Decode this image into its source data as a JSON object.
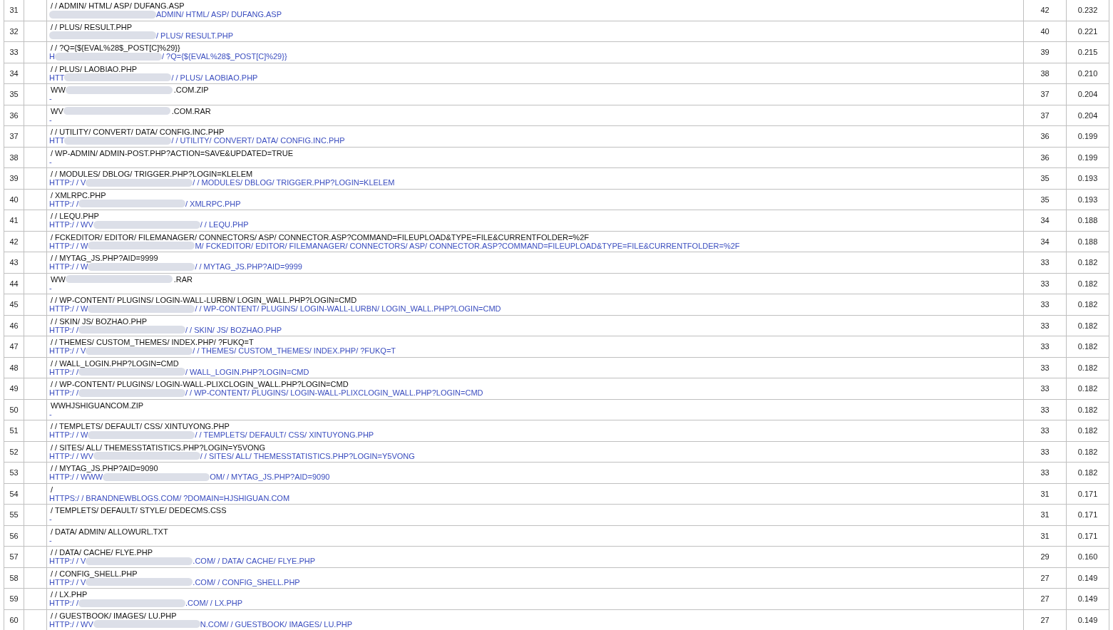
{
  "rows": [
    {
      "n": "31",
      "path": [
        {
          "text": "/ / ADMIN/ HTML/ ASP/ DUFANG.ASP"
        }
      ],
      "url": [
        {
          "kind": "redacted"
        },
        {
          "text": "ADMIN/ HTML/ ASP/ DUFANG.ASP"
        }
      ],
      "hits": "42",
      "ratio": "0.232"
    },
    {
      "n": "32",
      "path": [
        {
          "text": "/ / PLUS/ RESULT.PHP"
        }
      ],
      "url": [
        {
          "kind": "redacted"
        },
        {
          "text": "/ PLUS/ RESULT.PHP"
        }
      ],
      "hits": "40",
      "ratio": "0.221"
    },
    {
      "n": "33",
      "path": [
        {
          "text": "/ / ?Q={${EVAL%28$_POST[C]%29}}"
        }
      ],
      "url": [
        {
          "text": "H"
        },
        {
          "kind": "redacted"
        },
        {
          "text": "/ ?Q={${EVAL%28$_POST[C]%29}}"
        }
      ],
      "hits": "39",
      "ratio": "0.215"
    },
    {
      "n": "34",
      "path": [
        {
          "text": "/ / PLUS/ LAOBIAO.PHP"
        }
      ],
      "url": [
        {
          "text": "HTT"
        },
        {
          "kind": "redacted"
        },
        {
          "text": "/ / PLUS/ LAOBIAO.PHP"
        }
      ],
      "hits": "38",
      "ratio": "0.210"
    },
    {
      "n": "35",
      "path": [
        {
          "text": "WW"
        },
        {
          "kind": "redacted"
        },
        {
          "text": ".COM.ZIP"
        }
      ],
      "url": [
        {
          "text": "-"
        }
      ],
      "hits": "37",
      "ratio": "0.204"
    },
    {
      "n": "36",
      "path": [
        {
          "text": "WV"
        },
        {
          "kind": "redacted"
        },
        {
          "text": ".COM.RAR"
        }
      ],
      "url": [
        {
          "text": "-"
        }
      ],
      "hits": "37",
      "ratio": "0.204"
    },
    {
      "n": "37",
      "path": [
        {
          "text": "/ / UTILITY/ CONVERT/ DATA/ CONFIG.INC.PHP"
        }
      ],
      "url": [
        {
          "text": "HTT"
        },
        {
          "kind": "redacted"
        },
        {
          "text": "/ / UTILITY/ CONVERT/ DATA/ CONFIG.INC.PHP"
        }
      ],
      "hits": "36",
      "ratio": "0.199"
    },
    {
      "n": "38",
      "path": [
        {
          "text": "/ WP-ADMIN/ ADMIN-POST.PHP?ACTION=SAVE&UPDATED=TRUE"
        }
      ],
      "url": [
        {
          "text": "-"
        }
      ],
      "hits": "36",
      "ratio": "0.199"
    },
    {
      "n": "39",
      "path": [
        {
          "text": "/ / MODULES/ DBLOG/ TRIGGER.PHP?LOGIN=KLELEM"
        }
      ],
      "url": [
        {
          "text": "HTTP:/ / V"
        },
        {
          "kind": "redacted"
        },
        {
          "text": "/ / MODULES/ DBLOG/ TRIGGER.PHP?LOGIN=KLELEM"
        }
      ],
      "hits": "35",
      "ratio": "0.193"
    },
    {
      "n": "40",
      "path": [
        {
          "text": "/ XMLRPC.PHP"
        }
      ],
      "url": [
        {
          "text": "HTTP:/ /"
        },
        {
          "kind": "redacted"
        },
        {
          "text": "/ XMLRPC.PHP"
        }
      ],
      "hits": "35",
      "ratio": "0.193"
    },
    {
      "n": "41",
      "path": [
        {
          "text": "/ / LEQU.PHP"
        }
      ],
      "url": [
        {
          "text": "HTTP:/ / WV"
        },
        {
          "kind": "redacted"
        },
        {
          "text": "/ / LEQU.PHP"
        }
      ],
      "hits": "34",
      "ratio": "0.188"
    },
    {
      "n": "42",
      "path": [
        {
          "text": "/ FCKEDITOR/ EDITOR/ FILEMANAGER/ CONNECTORS/ ASP/ CONNECTOR.ASP?COMMAND=FILEUPLOAD&TYPE=FILE&CURRENTFOLDER=%2F"
        }
      ],
      "url": [
        {
          "text": "HTTP:/ / W"
        },
        {
          "kind": "redacted"
        },
        {
          "text": "M/ FCKEDITOR/ EDITOR/ FILEMANAGER/ CONNECTORS/ ASP/ CONNECTOR.ASP?COMMAND=FILEUPLOAD&TYPE=FILE&CURRENTFOLDER=%2F"
        }
      ],
      "hits": "34",
      "ratio": "0.188"
    },
    {
      "n": "43",
      "path": [
        {
          "text": "/ / MYTAG_JS.PHP?AID=9999"
        }
      ],
      "url": [
        {
          "text": "HTTP:/ / W"
        },
        {
          "kind": "redacted"
        },
        {
          "text": "/ / MYTAG_JS.PHP?AID=9999"
        }
      ],
      "hits": "33",
      "ratio": "0.182"
    },
    {
      "n": "44",
      "path": [
        {
          "text": "WW"
        },
        {
          "kind": "redacted"
        },
        {
          "text": ".RAR"
        }
      ],
      "url": [
        {
          "text": "-"
        }
      ],
      "hits": "33",
      "ratio": "0.182"
    },
    {
      "n": "45",
      "path": [
        {
          "text": "/ / WP-CONTENT/ PLUGINS/ LOGIN-WALL-LURBN/ LOGIN_WALL.PHP?LOGIN=CMD"
        }
      ],
      "url": [
        {
          "text": "HTTP:/ / W"
        },
        {
          "kind": "redacted"
        },
        {
          "text": "/ / WP-CONTENT/ PLUGINS/ LOGIN-WALL-LURBN/ LOGIN_WALL.PHP?LOGIN=CMD"
        }
      ],
      "hits": "33",
      "ratio": "0.182"
    },
    {
      "n": "46",
      "path": [
        {
          "text": "/ / SKIN/ JS/ BOZHAO.PHP"
        }
      ],
      "url": [
        {
          "text": "HTTP:/ /"
        },
        {
          "kind": "redacted"
        },
        {
          "text": "/ / SKIN/ JS/ BOZHAO.PHP"
        }
      ],
      "hits": "33",
      "ratio": "0.182"
    },
    {
      "n": "47",
      "path": [
        {
          "text": "/ / THEMES/ CUSTOM_THEMES/ INDEX.PHP/ ?FUKQ=T"
        }
      ],
      "url": [
        {
          "text": "HTTP:/ / V"
        },
        {
          "kind": "redacted"
        },
        {
          "text": "/ / THEMES/ CUSTOM_THEMES/ INDEX.PHP/ ?FUKQ=T"
        }
      ],
      "hits": "33",
      "ratio": "0.182"
    },
    {
      "n": "48",
      "path": [
        {
          "text": "/ / WALL_LOGIN.PHP?LOGIN=CMD"
        }
      ],
      "url": [
        {
          "text": "HTTP:/ /"
        },
        {
          "kind": "redacted"
        },
        {
          "text": "/ WALL_LOGIN.PHP?LOGIN=CMD"
        }
      ],
      "hits": "33",
      "ratio": "0.182"
    },
    {
      "n": "49",
      "path": [
        {
          "text": "/ / WP-CONTENT/ PLUGINS/ LOGIN-WALL-PLIXCLOGIN_WALL.PHP?LOGIN=CMD"
        }
      ],
      "url": [
        {
          "text": "HTTP:/ /"
        },
        {
          "kind": "redacted"
        },
        {
          "text": "/ / WP-CONTENT/ PLUGINS/ LOGIN-WALL-PLIXCLOGIN_WALL.PHP?LOGIN=CMD"
        }
      ],
      "hits": "33",
      "ratio": "0.182"
    },
    {
      "n": "50",
      "path": [
        {
          "text": "WWHJSHIGUANCOM.ZIP"
        }
      ],
      "url": [
        {
          "text": "-"
        }
      ],
      "hits": "33",
      "ratio": "0.182"
    },
    {
      "n": "51",
      "path": [
        {
          "text": "/ / TEMPLETS/ DEFAULT/ CSS/ XINTUYONG.PHP"
        }
      ],
      "url": [
        {
          "text": "HTTP:/ / W"
        },
        {
          "kind": "redacted"
        },
        {
          "text": "/ / TEMPLETS/ DEFAULT/ CSS/ XINTUYONG.PHP"
        }
      ],
      "hits": "33",
      "ratio": "0.182"
    },
    {
      "n": "52",
      "path": [
        {
          "text": "/ / SITES/ ALL/ THEMESSTATISTICS.PHP?LOGIN=Y5VONG"
        }
      ],
      "url": [
        {
          "text": "HTTP:/ / WV"
        },
        {
          "kind": "redacted"
        },
        {
          "text": "/ / SITES/ ALL/ THEMESSTATISTICS.PHP?LOGIN=Y5VONG"
        }
      ],
      "hits": "33",
      "ratio": "0.182"
    },
    {
      "n": "53",
      "path": [
        {
          "text": "/ / MYTAG_JS.PHP?AID=9090"
        }
      ],
      "url": [
        {
          "text": "HTTP:/ / WWW"
        },
        {
          "kind": "redacted"
        },
        {
          "text": "OM/ / MYTAG_JS.PHP?AID=9090"
        }
      ],
      "hits": "33",
      "ratio": "0.182"
    },
    {
      "n": "54",
      "path": [
        {
          "text": "/"
        }
      ],
      "url": [
        {
          "text": "HTTPS:/ / BRANDNEWBLOGS.COM/ ?DOMAIN=HJSHIGUAN.COM"
        }
      ],
      "hits": "31",
      "ratio": "0.171"
    },
    {
      "n": "55",
      "path": [
        {
          "text": "/ TEMPLETS/ DEFAULT/ STYLE/ DEDECMS.CSS"
        }
      ],
      "url": [
        {
          "text": "-"
        }
      ],
      "hits": "31",
      "ratio": "0.171"
    },
    {
      "n": "56",
      "path": [
        {
          "text": "/ DATA/ ADMIN/ ALLOWURL.TXT"
        }
      ],
      "url": [
        {
          "text": "-"
        }
      ],
      "hits": "31",
      "ratio": "0.171"
    },
    {
      "n": "57",
      "path": [
        {
          "text": "/ / DATA/ CACHE/ FLYE.PHP"
        }
      ],
      "url": [
        {
          "text": "HTTP:/ / V"
        },
        {
          "kind": "redacted"
        },
        {
          "text": ".COM/ / DATA/ CACHE/ FLYE.PHP"
        }
      ],
      "hits": "29",
      "ratio": "0.160"
    },
    {
      "n": "58",
      "path": [
        {
          "text": "/ / CONFIG_SHELL.PHP"
        }
      ],
      "url": [
        {
          "text": "HTTP:/ / V"
        },
        {
          "kind": "redacted"
        },
        {
          "text": ".COM/ / CONFIG_SHELL.PHP"
        }
      ],
      "hits": "27",
      "ratio": "0.149"
    },
    {
      "n": "59",
      "path": [
        {
          "text": "/ / LX.PHP"
        }
      ],
      "url": [
        {
          "text": "HTTP:/ /"
        },
        {
          "kind": "redacted"
        },
        {
          "text": ".COM/ / LX.PHP"
        }
      ],
      "hits": "27",
      "ratio": "0.149"
    },
    {
      "n": "60",
      "path": [
        {
          "text": "/ / GUESTBOOK/ IMAGES/ LU.PHP"
        }
      ],
      "url": [
        {
          "text": "HTTP:/ / WV"
        },
        {
          "kind": "redacted"
        },
        {
          "text": "N.COM/ / GUESTBOOK/ IMAGES/ LU.PHP"
        }
      ],
      "hits": "27",
      "ratio": "0.149"
    }
  ]
}
